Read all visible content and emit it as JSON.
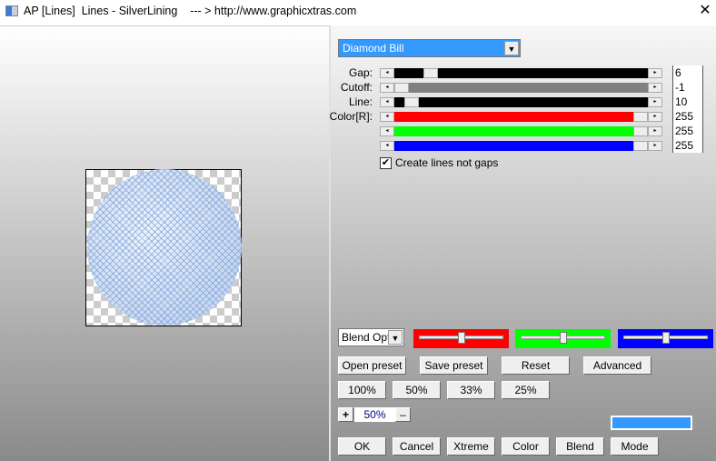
{
  "window": {
    "title": "AP [Lines]  Lines - SilverLining    --- > http://www.graphicxtras.com",
    "close": "✕"
  },
  "preset": {
    "selected": "Diamond Bill"
  },
  "sliders": [
    {
      "label": "Gap:",
      "value": "6",
      "fill": "#000000",
      "position": 0.12
    },
    {
      "label": "Cutoff:",
      "value": "-1",
      "fill": "#808080",
      "position": 0.0
    },
    {
      "label": "Line:",
      "value": "10",
      "fill": "#000000",
      "position": 0.04
    },
    {
      "label": "Color[R]:",
      "value": "255",
      "fill": "#ff0000",
      "position": 1.0
    },
    {
      "label": "",
      "value": "255",
      "fill": "#00ff00",
      "position": 1.0
    },
    {
      "label": "",
      "value": "255",
      "fill": "#0000ff",
      "position": 1.0
    }
  ],
  "checkbox": {
    "label": "Create lines not gaps",
    "checked": true
  },
  "blend": {
    "selected": "Blend Optio"
  },
  "color_sliders": [
    {
      "color": "#ff0000",
      "position": 0.5
    },
    {
      "color": "#00ff00",
      "position": 0.5
    },
    {
      "color": "#0000ff",
      "position": 0.5
    }
  ],
  "buttons": {
    "open_preset": "Open preset",
    "save_preset": "Save preset",
    "reset": "Reset",
    "advanced": "Advanced",
    "z100": "100%",
    "z50": "50%",
    "z33": "33%",
    "z25": "25%",
    "ok": "OK",
    "cancel": "Cancel",
    "xtreme": "Xtreme",
    "color": "Color",
    "blend": "Blend",
    "mode": "Mode"
  },
  "zoom": {
    "plus": "+",
    "value": "50%",
    "minus": "–"
  },
  "swatch_color": "#3399ff"
}
